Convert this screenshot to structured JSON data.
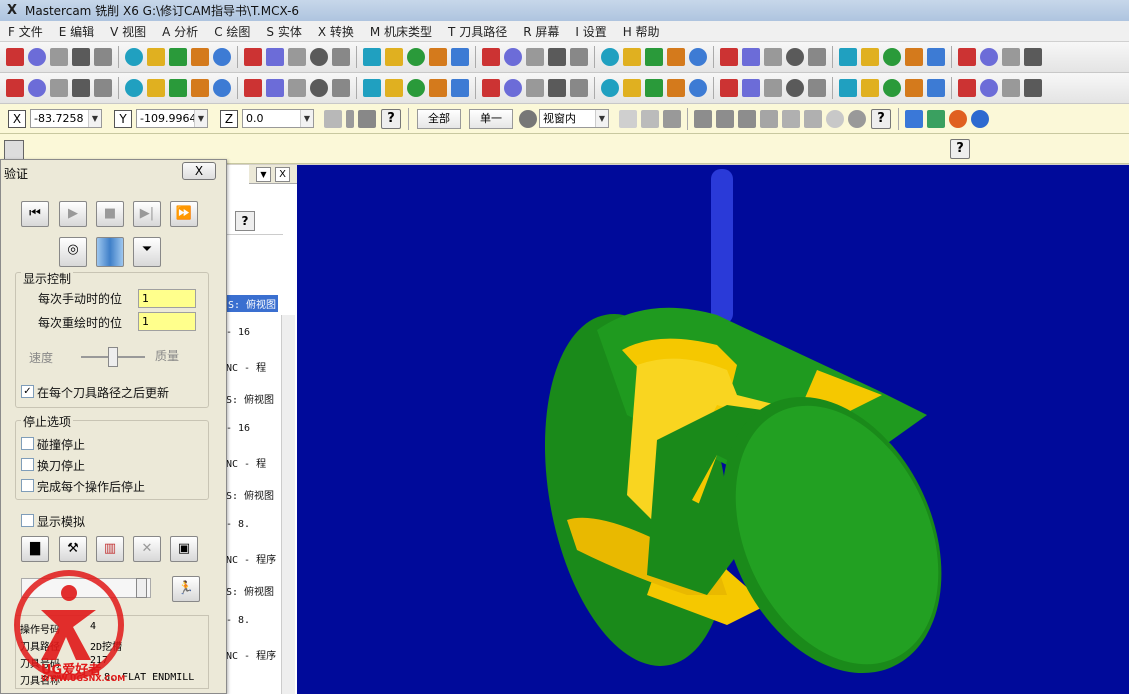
{
  "window": {
    "title": "Mastercam 铣削 X6  G:\\修订CAM指导书\\T.MCX-6"
  },
  "menu": [
    "F 文件",
    "E 编辑",
    "V 视图",
    "A 分析",
    "C 绘图",
    "S 实体",
    "X 转换",
    "M 机床类型",
    "T 刀具路径",
    "R 屏幕",
    "I 设置",
    "H 帮助"
  ],
  "coords": {
    "x_label": "X",
    "x_value": "-83.7258",
    "y_label": "Y",
    "y_value": "-109.9964",
    "z_label": "Z",
    "z_value": "0.0",
    "btn_all": "全部",
    "btn_single": "单一",
    "view_select": "视窗内"
  },
  "ops_manager": {
    "lines": [
      "S: 俯视图",
      "-   16",
      "NC - 程",
      "S: 俯视图",
      "-   16",
      "NC - 程",
      "S: 俯视图",
      "-   8.",
      "NC - 程序",
      "S: 俯视图",
      "-   8.",
      "NC - 程序"
    ]
  },
  "verify": {
    "title": "验证",
    "close": "X",
    "display_group": "显示控制",
    "step_label": "每次手动时的位",
    "step_value": "1",
    "redraw_label": "每次重绘时的位",
    "redraw_value": "1",
    "speed_label": "速度",
    "quality_label": "质量",
    "update_label": "在每个刀具路径之后更新",
    "stop_group": "停止选项",
    "stop_collision": "碰撞停止",
    "stop_toolchange": "换刀停止",
    "stop_each_op": "完成每个操作后停止",
    "show_sim": "显示模拟",
    "info_op_label": "操作号码",
    "info_op_value": "4",
    "info_type_label": "刀具路径",
    "info_type_value": "2D挖槽",
    "info_toolnum_label": "刀具号码",
    "info_toolnum_value": "217",
    "info_toolname_label": "刀具名称",
    "info_toolname_value": "8. FLAT ENDMILL"
  },
  "watermark": {
    "brand": "UG爱好者",
    "url": "WWW.UGSNX.COM"
  },
  "colors": {
    "viewport_bg": "#000a9a",
    "stock_green": "#1a8a1a",
    "part_yellow": "#f5c800",
    "tool_blue": "#2a3ad8",
    "field_yellow": "#ffff8c"
  }
}
